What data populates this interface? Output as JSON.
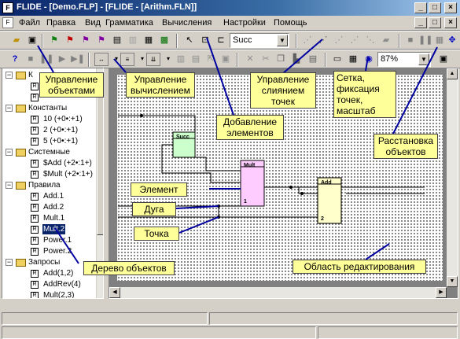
{
  "window": {
    "title": "FLIDE - [Demo.FLP] - [FLIDE - [Arithm.FLN]]",
    "app_icon": "F",
    "buttons": [
      "_",
      "□",
      "×"
    ],
    "doc_buttons": [
      "_",
      "□",
      "×"
    ]
  },
  "menu": {
    "doc_icon": "F",
    "items": [
      "Файл",
      "Правка",
      "Вид",
      "Грамматика",
      "Вычисления",
      "Настройки",
      "Помощь"
    ]
  },
  "toolbar": {
    "element_combo_value": "Succ",
    "zoom_value": "87%"
  },
  "tree": {
    "rows": [
      {
        "kind": "folder",
        "label": "К",
        "expanded": true
      },
      {
        "kind": "leaf",
        "label": ""
      },
      {
        "kind": "leaf",
        "label": ""
      },
      {
        "kind": "folder",
        "label": "Константы",
        "expanded": true
      },
      {
        "kind": "leaf",
        "label": "10 (+0•:+1)"
      },
      {
        "kind": "leaf",
        "label": "2 (+0•:+1)"
      },
      {
        "kind": "leaf",
        "label": "5 (+0•:+1)"
      },
      {
        "kind": "folder",
        "label": "Системные",
        "expanded": true
      },
      {
        "kind": "leaf",
        "label": "$Add (+2•:1+)"
      },
      {
        "kind": "leaf",
        "label": "$Mult (+2•:1+)"
      },
      {
        "kind": "folder",
        "label": "Правила",
        "expanded": true
      },
      {
        "kind": "leaf",
        "label": "Add.1"
      },
      {
        "kind": "leaf",
        "label": "Add.2"
      },
      {
        "kind": "leaf",
        "label": "Mult.1"
      },
      {
        "kind": "leaf",
        "label": "Mult.2",
        "selected": true
      },
      {
        "kind": "leaf",
        "label": "Power.1"
      },
      {
        "kind": "leaf",
        "label": "Power.2"
      },
      {
        "kind": "folder",
        "label": "Запросы",
        "expanded": true
      },
      {
        "kind": "leaf",
        "label": "Add(1,2)"
      },
      {
        "kind": "leaf",
        "label": "AddRev(4)"
      },
      {
        "kind": "leaf",
        "label": "Mult(2,3)"
      }
    ]
  },
  "diagram": {
    "succ_label": "Succ",
    "mult_label": "Mult",
    "mult_port": "1",
    "add_label": "Add",
    "add_port": "2"
  },
  "callouts": {
    "objects_mgmt": "Управление\nобъектами",
    "calc_mgmt": "Управление\nвычислением",
    "add_elements": "Добавление\nэлементов",
    "merge_points": "Управление\nслиянием\nточек",
    "grid": "Сетка,\nфиксация\nточек,\nмасштаб",
    "arrange": "Расстановка\nобъектов",
    "element": "Элемент",
    "arc": "Дуга",
    "point": "Точка",
    "tree": "Дерево объектов",
    "edit_area": "Область редактирования"
  },
  "colors": {
    "titlebar": "#0a246a",
    "callout_bg": "#ffff99",
    "callout_line": "#0000a0",
    "succ_fill": "#ccffcc",
    "mult_fill": "#ffccff",
    "add_fill": "#ffffcc"
  }
}
